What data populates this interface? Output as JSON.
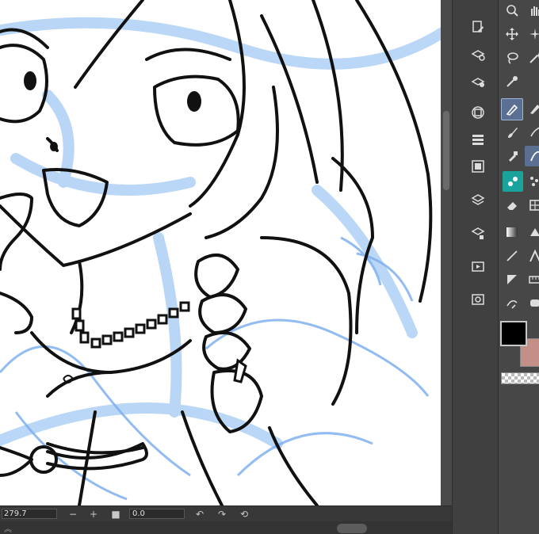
{
  "canvas": {
    "artwork": "line-art-sketch"
  },
  "statusbar": {
    "zoom_value": "279.7",
    "zoom_out_label": "−",
    "zoom_in_label": "+",
    "rotation_value": "0.0"
  },
  "colors": {
    "main": "#000000",
    "sub": "#c48f87",
    "sketch_blue": "#a9cdf5",
    "ui_dark": "#404040"
  },
  "dock_icons": [
    "page-settings-icon",
    "layer-props-icon",
    "auto-action-icon",
    "navigator-icon",
    "sub-view-icon",
    "timeline-icon",
    "layers-icon",
    "material-icon",
    "animation-icon",
    "preview-icon"
  ],
  "tool_icons": [
    "zoom-icon",
    "hand-icon",
    "move-icon",
    "sparkle-icon",
    "lasso-icon",
    "magic-wand-icon",
    "eyedropper-icon",
    "pen-icon",
    "pencil-icon",
    "brush-icon",
    "airbrush-icon",
    "decoration-icon",
    "eraser-icon",
    "fill-icon",
    "gradient-icon",
    "figure-icon",
    "line-icon",
    "text-icon",
    "frame-icon",
    "ruler-icon",
    "correct-line-icon",
    "balloon-icon"
  ]
}
